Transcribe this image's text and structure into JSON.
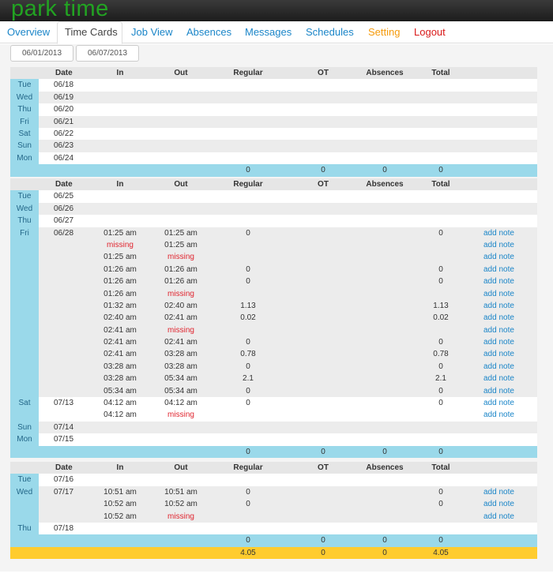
{
  "app": {
    "title": "park time"
  },
  "nav": {
    "overview": "Overview",
    "timecards": "Time Cards",
    "jobview": "Job View",
    "absences": "Absences",
    "messages": "Messages",
    "schedules": "Schedules",
    "setting": "Setting",
    "logout": "Logout"
  },
  "filters": {
    "start": "06/01/2013",
    "end": "06/07/2013"
  },
  "columns": {
    "date": "Date",
    "in": "In",
    "out": "Out",
    "regular": "Regular",
    "ot": "OT",
    "absences": "Absences",
    "total": "Total"
  },
  "add_note_label": "add note",
  "colors": {
    "brand": "#22a322",
    "link": "#1a85c8",
    "missing": "#e0242e",
    "summary": "#9ad9ea",
    "grand": "#ffcc2e"
  },
  "weeks": [
    {
      "days": [
        {
          "day": "Tue",
          "date": "06/18",
          "entries": []
        },
        {
          "day": "Wed",
          "date": "06/19",
          "entries": []
        },
        {
          "day": "Thu",
          "date": "06/20",
          "entries": []
        },
        {
          "day": "Fri",
          "date": "06/21",
          "entries": []
        },
        {
          "day": "Sat",
          "date": "06/22",
          "entries": []
        },
        {
          "day": "Sun",
          "date": "06/23",
          "entries": []
        },
        {
          "day": "Mon",
          "date": "06/24",
          "entries": []
        }
      ],
      "summary": {
        "regular": "0",
        "ot": "0",
        "absences": "0",
        "total": "0"
      }
    },
    {
      "days": [
        {
          "day": "Tue",
          "date": "06/25",
          "entries": []
        },
        {
          "day": "Wed",
          "date": "06/26",
          "entries": []
        },
        {
          "day": "Thu",
          "date": "06/27",
          "entries": []
        },
        {
          "day": "Fri",
          "date": "06/28",
          "entries": [
            {
              "in": "01:25 am",
              "out": "01:25 am",
              "regular": "0",
              "total": "0"
            },
            {
              "in": "missing",
              "out": "01:25 am",
              "regular": "",
              "total": ""
            },
            {
              "in": "01:25 am",
              "out": "missing",
              "regular": "",
              "total": ""
            },
            {
              "in": "01:26 am",
              "out": "01:26 am",
              "regular": "0",
              "total": "0"
            },
            {
              "in": "01:26 am",
              "out": "01:26 am",
              "regular": "0",
              "total": "0"
            },
            {
              "in": "01:26 am",
              "out": "missing",
              "regular": "",
              "total": ""
            },
            {
              "in": "01:32 am",
              "out": "02:40 am",
              "regular": "1.13",
              "total": "1.13"
            },
            {
              "in": "02:40 am",
              "out": "02:41 am",
              "regular": "0.02",
              "total": "0.02"
            },
            {
              "in": "02:41 am",
              "out": "missing",
              "regular": "",
              "total": ""
            },
            {
              "in": "02:41 am",
              "out": "02:41 am",
              "regular": "0",
              "total": "0"
            },
            {
              "in": "02:41 am",
              "out": "03:28 am",
              "regular": "0.78",
              "total": "0.78"
            },
            {
              "in": "03:28 am",
              "out": "03:28 am",
              "regular": "0",
              "total": "0"
            },
            {
              "in": "03:28 am",
              "out": "05:34 am",
              "regular": "2.1",
              "total": "2.1"
            },
            {
              "in": "05:34 am",
              "out": "05:34 am",
              "regular": "0",
              "total": "0"
            }
          ]
        },
        {
          "day": "Sat",
          "date": "07/13",
          "entries": [
            {
              "in": "04:12 am",
              "out": "04:12 am",
              "regular": "0",
              "total": "0"
            },
            {
              "in": "04:12 am",
              "out": "missing",
              "regular": "",
              "total": ""
            }
          ]
        },
        {
          "day": "Sun",
          "date": "07/14",
          "entries": []
        },
        {
          "day": "Mon",
          "date": "07/15",
          "entries": []
        }
      ],
      "summary": {
        "regular": "0",
        "ot": "0",
        "absences": "0",
        "total": "0"
      }
    },
    {
      "days": [
        {
          "day": "Tue",
          "date": "07/16",
          "entries": []
        },
        {
          "day": "Wed",
          "date": "07/17",
          "entries": [
            {
              "in": "10:51 am",
              "out": "10:51 am",
              "regular": "0",
              "total": "0"
            },
            {
              "in": "10:52 am",
              "out": "10:52 am",
              "regular": "0",
              "total": "0"
            },
            {
              "in": "10:52 am",
              "out": "missing",
              "regular": "",
              "total": ""
            }
          ]
        },
        {
          "day": "Thu",
          "date": "07/18",
          "entries": []
        }
      ],
      "summary": {
        "regular": "0",
        "ot": "0",
        "absences": "0",
        "total": "0"
      }
    }
  ],
  "grand_total": {
    "regular": "4.05",
    "ot": "0",
    "absences": "0",
    "total": "4.05"
  }
}
